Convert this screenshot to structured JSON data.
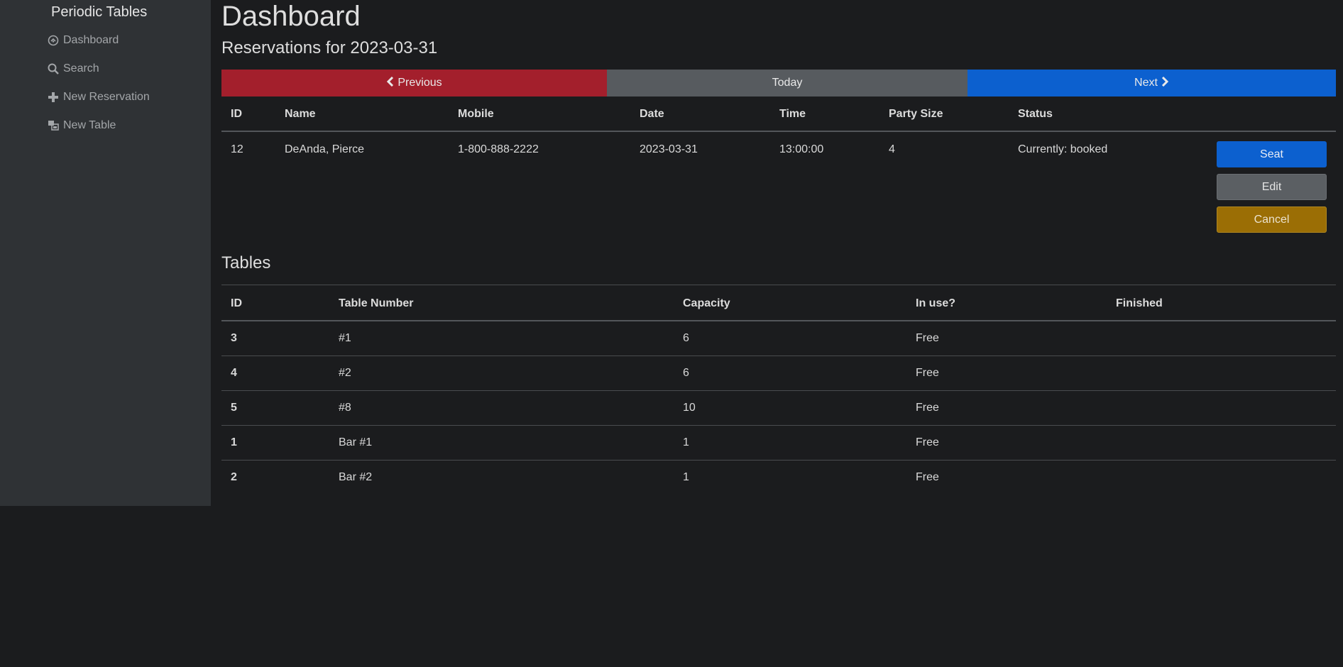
{
  "sidebar": {
    "brand": "Periodic Tables",
    "items": [
      {
        "label": "Dashboard",
        "icon": "dashboard-icon"
      },
      {
        "label": "Search",
        "icon": "search-icon"
      },
      {
        "label": "New Reservation",
        "icon": "plus-icon"
      },
      {
        "label": "New Table",
        "icon": "table-icon"
      }
    ]
  },
  "main": {
    "title": "Dashboard",
    "subtitle": "Reservations for 2023-03-31",
    "nav": {
      "previous": "Previous",
      "today": "Today",
      "next": "Next"
    },
    "reservations": {
      "headers": [
        "ID",
        "Name",
        "Mobile",
        "Date",
        "Time",
        "Party Size",
        "Status"
      ],
      "rows": [
        {
          "id": "12",
          "name": "DeAnda, Pierce",
          "mobile": "1-800-888-2222",
          "date": "2023-03-31",
          "time": "13:00:00",
          "party_size": "4",
          "status": "Currently: booked",
          "actions": {
            "seat": "Seat",
            "edit": "Edit",
            "cancel": "Cancel"
          }
        }
      ]
    },
    "tables": {
      "title": "Tables",
      "headers": [
        "ID",
        "Table Number",
        "Capacity",
        "In use?",
        "Finished"
      ],
      "rows": [
        {
          "id": "3",
          "number": "#1",
          "capacity": "6",
          "status": "Free"
        },
        {
          "id": "4",
          "number": "#2",
          "capacity": "6",
          "status": "Free"
        },
        {
          "id": "5",
          "number": "#8",
          "capacity": "10",
          "status": "Free"
        },
        {
          "id": "1",
          "number": "Bar #1",
          "capacity": "1",
          "status": "Free"
        },
        {
          "id": "2",
          "number": "Bar #2",
          "capacity": "1",
          "status": "Free"
        }
      ]
    }
  },
  "colors": {
    "background": "#1b1c1e",
    "sidebar": "#2f3235",
    "danger": "#a31f2c",
    "secondary": "#575b5f",
    "primary": "#0c60cf",
    "warning": "#9b6e05"
  }
}
